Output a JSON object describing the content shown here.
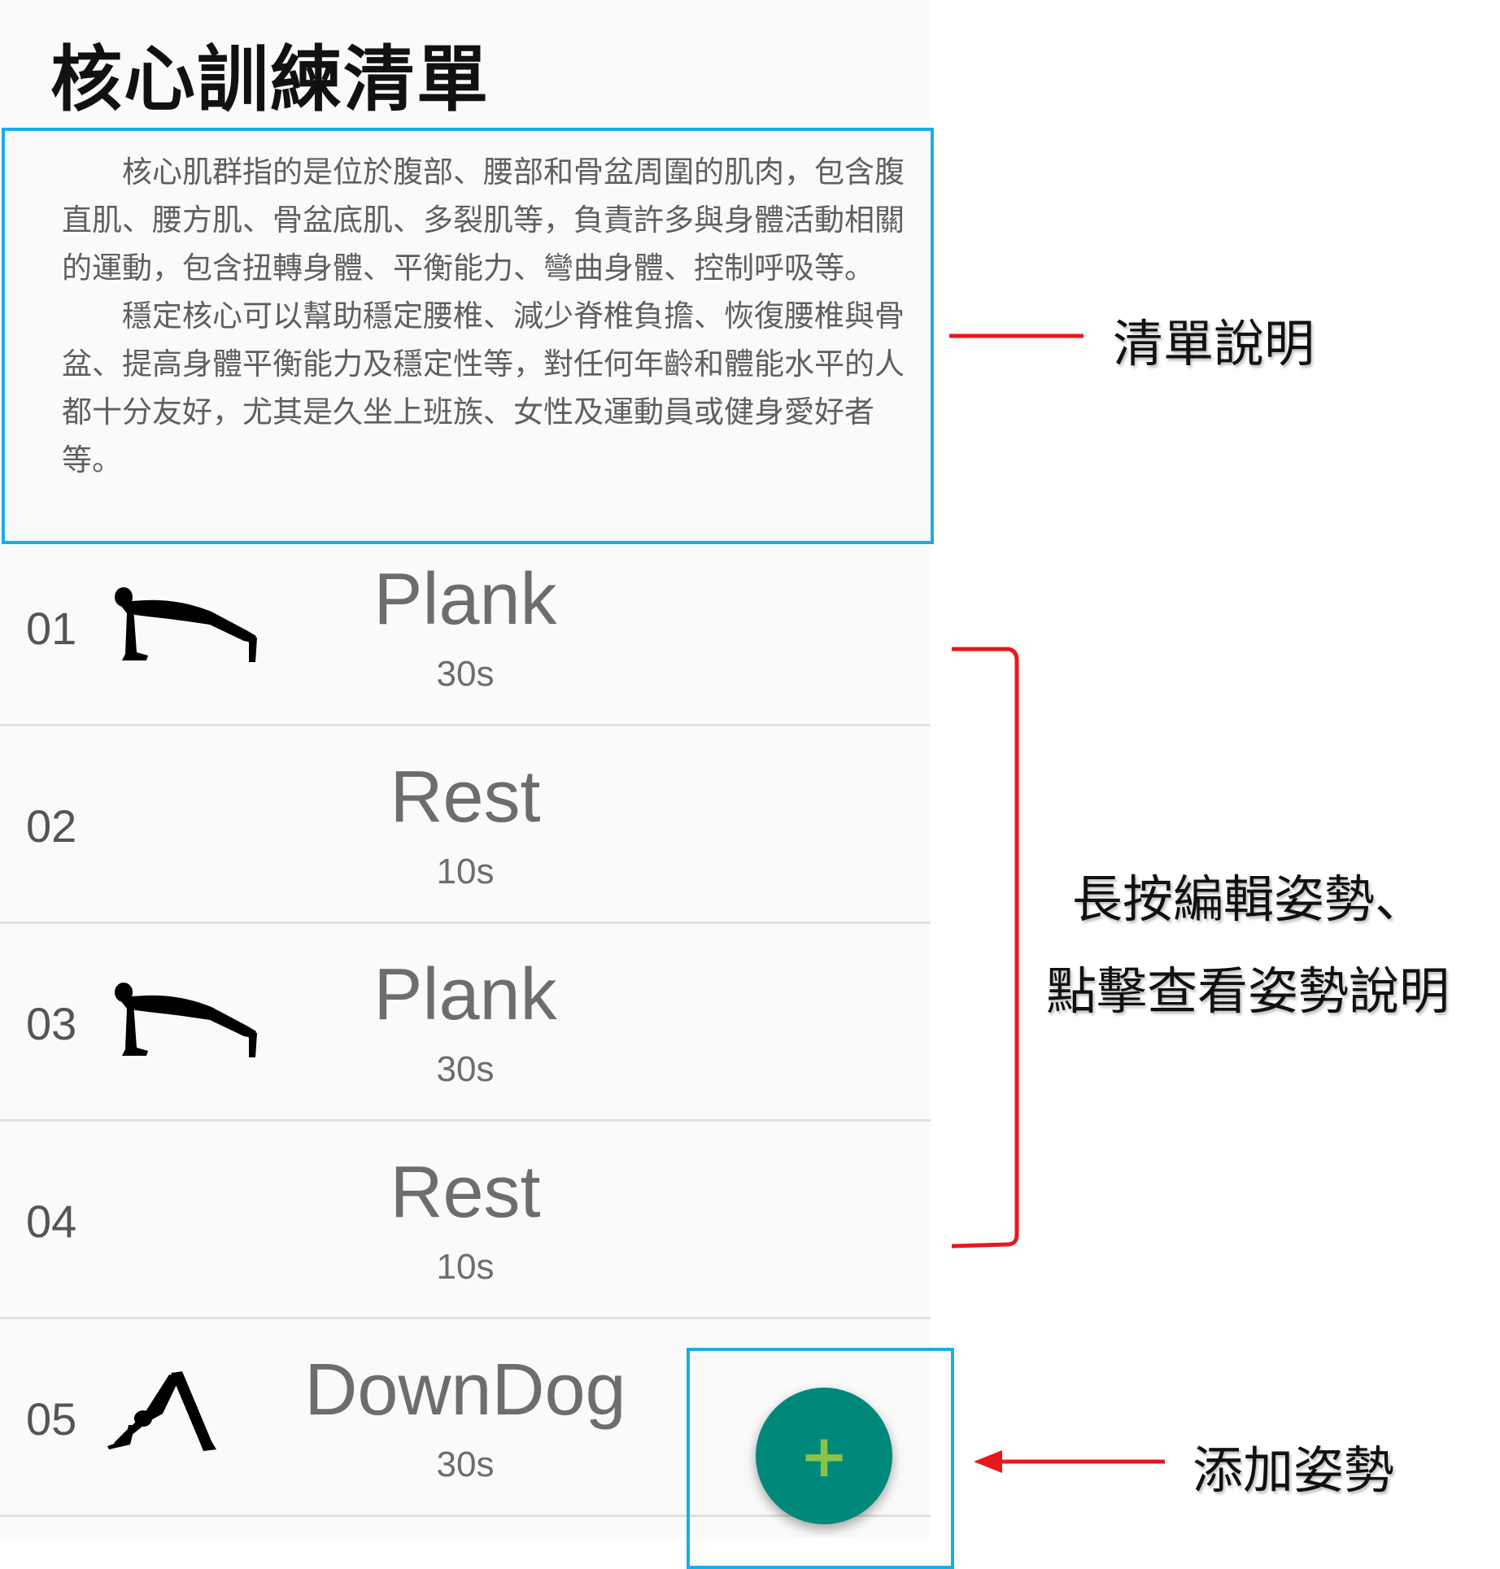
{
  "page_title": "核心訓練清單",
  "description": {
    "paragraph_1": "核心肌群指的是位於腹部、腰部和骨盆周圍的肌肉，包含腹直肌、腰方肌、骨盆底肌、多裂肌等，負責許多與身體活動相關的運動，包含扭轉身體、平衡能力、彎曲身體、控制呼吸等。",
    "paragraph_2": "穩定核心可以幫助穩定腰椎、減少脊椎負擔、恢復腰椎與骨盆、提高身體平衡能力及穩定性等，對任何年齡和體能水平的人都十分友好，尤其是久坐上班族、女性及運動員或健身愛好者等。"
  },
  "exercises": [
    {
      "number": "01",
      "name": "Plank",
      "duration": "30s",
      "icon": "plank-figure-icon"
    },
    {
      "number": "02",
      "name": "Rest",
      "duration": "10s",
      "icon": ""
    },
    {
      "number": "03",
      "name": "Plank",
      "duration": "30s",
      "icon": "plank-figure-icon"
    },
    {
      "number": "04",
      "name": "Rest",
      "duration": "10s",
      "icon": ""
    },
    {
      "number": "05",
      "name": "DownDog",
      "duration": "30s",
      "icon": "downdog-figure-icon"
    }
  ],
  "fab": {
    "symbol": "+",
    "color": "#00897b",
    "symbol_color": "#8bc34a"
  },
  "annotations": {
    "description_label": "清單說明",
    "list_label_line1": "長按編輯姿勢、",
    "list_label_line2": "點擊查看姿勢說明",
    "fab_label": "添加姿勢",
    "highlight_color": "#1aaee8",
    "arrow_color": "#e5181e"
  }
}
